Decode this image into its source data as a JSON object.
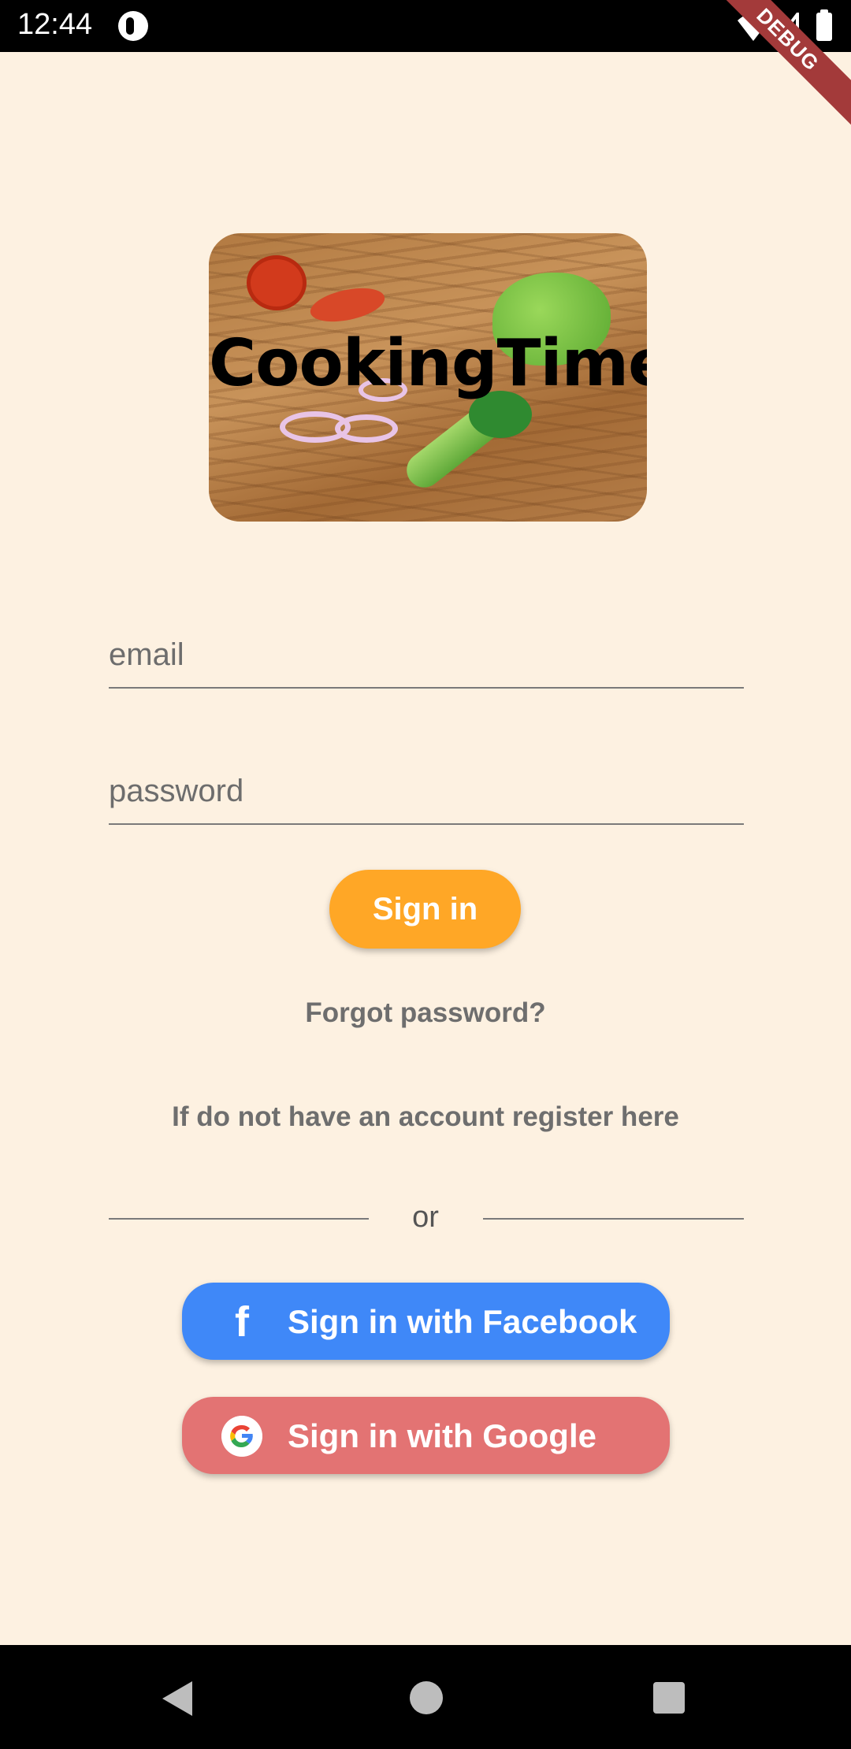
{
  "status_bar": {
    "time": "12:44",
    "debug_label": "DEBUG"
  },
  "logo": {
    "title": "CookingTime"
  },
  "form": {
    "email_placeholder": "email",
    "password_placeholder": "password",
    "email_value": "",
    "password_value": ""
  },
  "actions": {
    "sign_in_label": "Sign in",
    "forgot_password_label": "Forgot password?",
    "register_label": "If do not have an account register here",
    "divider_label": "or",
    "facebook_label": "Sign in with Facebook",
    "google_label": "Sign in with Google"
  },
  "icons": {
    "facebook": "facebook-icon",
    "google": "google-icon",
    "wifi": "wifi-icon",
    "signal": "signal-icon",
    "battery": "battery-icon"
  },
  "colors": {
    "background": "#fdf1e1",
    "sign_in_button": "#ffa726",
    "facebook_button": "#3f88f8",
    "google_button": "#e37373",
    "link_text": "#6e6e6e"
  }
}
